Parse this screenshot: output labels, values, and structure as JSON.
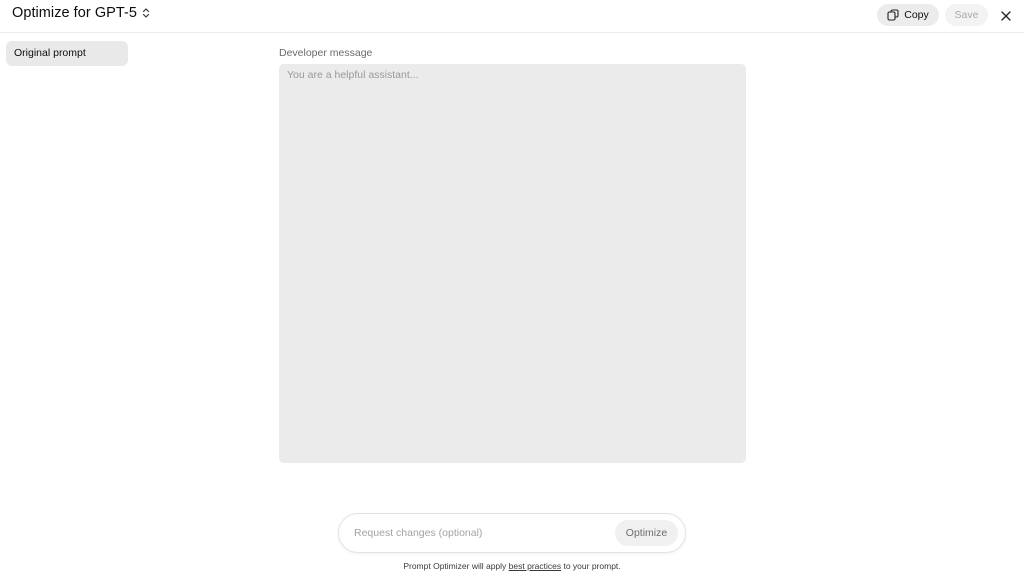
{
  "header": {
    "title": "Optimize for GPT-5",
    "title_icon": "chevron-up-down-icon",
    "copy_label": "Copy",
    "copy_icon": "copy-icon",
    "save_label": "Save",
    "close_icon": "close-icon"
  },
  "sidebar": {
    "items": [
      {
        "label": "Original prompt",
        "selected": true
      }
    ]
  },
  "main": {
    "developer_label": "Developer message",
    "developer_value": "",
    "developer_placeholder": "You are a helpful assistant..."
  },
  "request": {
    "value": "",
    "placeholder": "Request changes (optional)",
    "optimize_label": "Optimize"
  },
  "footer": {
    "prefix": "Prompt Optimizer will apply ",
    "link": "best practices",
    "suffix": " to your prompt."
  },
  "colors": {
    "textarea_bg": "#ebebeb",
    "selected_bg": "#e9e9e9",
    "pill_bg": "#ececec"
  }
}
